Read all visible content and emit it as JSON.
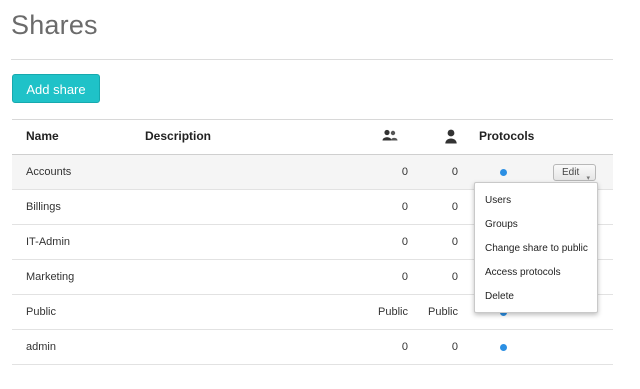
{
  "page": {
    "title": "Shares"
  },
  "toolbar": {
    "add_share_label": "Add share"
  },
  "table": {
    "columns": {
      "name": "Name",
      "description": "Description",
      "groups_icon": "users-icon",
      "users_icon": "user-icon",
      "protocols": "Protocols"
    },
    "rows": [
      {
        "name": "Accounts",
        "description": "",
        "groups": "0",
        "users": "0",
        "protocol_dot": true
      },
      {
        "name": "Billings",
        "description": "",
        "groups": "0",
        "users": "0",
        "protocol_dot": true
      },
      {
        "name": "IT-Admin",
        "description": "",
        "groups": "0",
        "users": "0",
        "protocol_dot": true
      },
      {
        "name": "Marketing",
        "description": "",
        "groups": "0",
        "users": "0",
        "protocol_dot": true
      },
      {
        "name": "Public",
        "description": "",
        "groups": "Public",
        "users": "Public",
        "protocol_dot": true
      },
      {
        "name": "admin",
        "description": "",
        "groups": "0",
        "users": "0",
        "protocol_dot": true
      }
    ],
    "edit_label": "Edit",
    "edit_caret": "▾"
  },
  "dropdown": {
    "items": [
      "Users",
      "Groups",
      "Change share to public",
      "Access protocols",
      "Delete"
    ]
  },
  "colors": {
    "accent": "#1fc2c8",
    "protocol_dot": "#2b8fe3"
  }
}
